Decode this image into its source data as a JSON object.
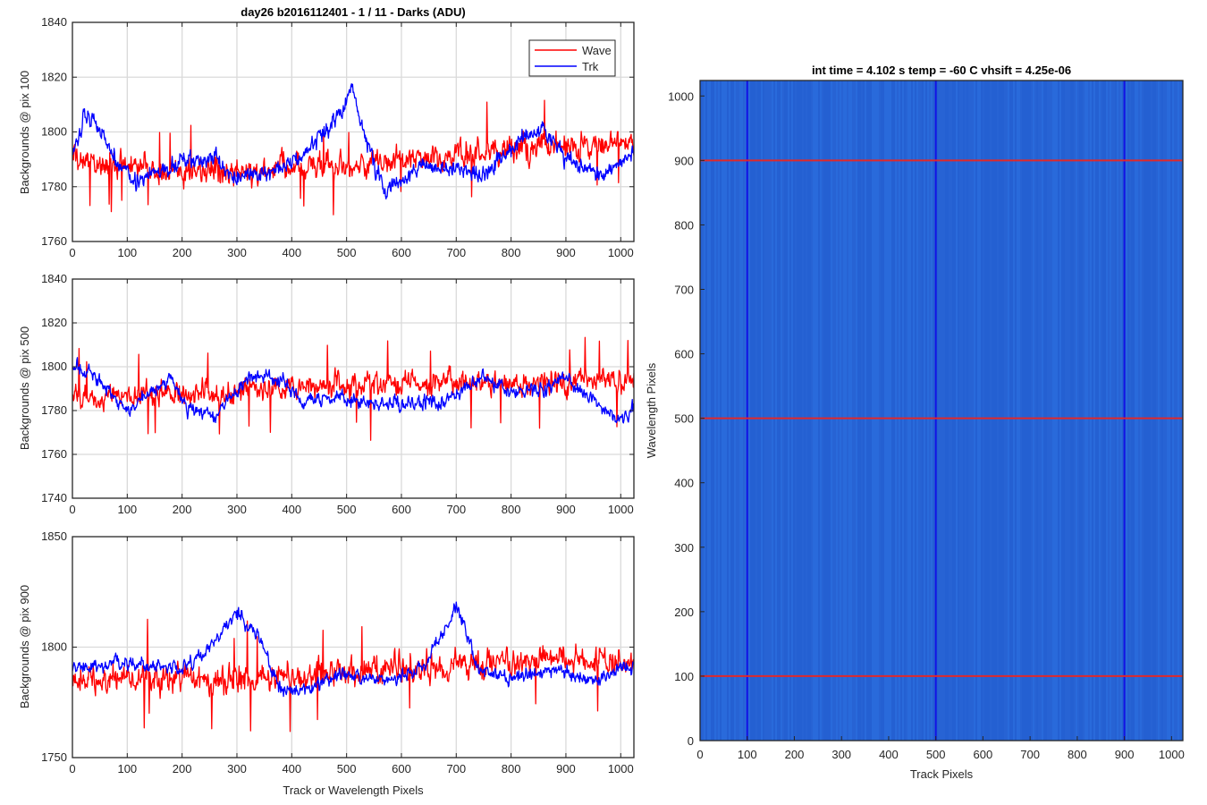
{
  "chart_data": [
    {
      "type": "line",
      "title": "day26 b2016112401 - 1 / 11 - Darks (ADU)",
      "xlabel": "",
      "ylabel": "Backgrounds @ pix 100",
      "xlim": [
        0,
        1024
      ],
      "ylim": [
        1760,
        1840
      ],
      "xticks": [
        "0",
        "100",
        "200",
        "300",
        "400",
        "500",
        "600",
        "700",
        "800",
        "900",
        "1000"
      ],
      "yticks": [
        "1760",
        "1780",
        "1800",
        "1820",
        "1840"
      ],
      "grid": true,
      "legend": {
        "placement": "top-right",
        "entries": [
          "Wave",
          "Trk"
        ]
      },
      "series": [
        {
          "name": "Wave",
          "color": "#ff0000",
          "mean": 1788,
          "noise": 6,
          "features": [
            [
              0,
              1790
            ],
            [
              100,
              1788
            ],
            [
              200,
              1786
            ],
            [
              300,
              1785
            ],
            [
              400,
              1787
            ],
            [
              500,
              1788
            ],
            [
              600,
              1790
            ],
            [
              700,
              1792
            ],
            [
              800,
              1794
            ],
            [
              900,
              1795
            ],
            [
              1024,
              1796
            ]
          ]
        },
        {
          "name": "Trk",
          "color": "#0000ff",
          "mean": 1789,
          "noise": 4,
          "features": [
            [
              0,
              1790
            ],
            [
              20,
              1806
            ],
            [
              40,
              1805
            ],
            [
              80,
              1790
            ],
            [
              120,
              1782
            ],
            [
              200,
              1789
            ],
            [
              260,
              1790
            ],
            [
              300,
              1783
            ],
            [
              360,
              1785
            ],
            [
              420,
              1792
            ],
            [
              490,
              1806
            ],
            [
              510,
              1818
            ],
            [
              530,
              1800
            ],
            [
              570,
              1778
            ],
            [
              640,
              1788
            ],
            [
              700,
              1787
            ],
            [
              760,
              1785
            ],
            [
              820,
              1798
            ],
            [
              860,
              1800
            ],
            [
              900,
              1790
            ],
            [
              960,
              1784
            ],
            [
              1024,
              1793
            ]
          ]
        }
      ]
    },
    {
      "type": "line",
      "title": "",
      "xlabel": "",
      "ylabel": "Backgrounds @ pix 500",
      "xlim": [
        0,
        1024
      ],
      "ylim": [
        1740,
        1840
      ],
      "xticks": [
        "0",
        "100",
        "200",
        "300",
        "400",
        "500",
        "600",
        "700",
        "800",
        "900",
        "1000"
      ],
      "yticks": [
        "1740",
        "1760",
        "1780",
        "1800",
        "1820",
        "1840"
      ],
      "grid": true,
      "series": [
        {
          "name": "Wave",
          "color": "#ff0000",
          "mean": 1788,
          "noise": 7,
          "features": [
            [
              0,
              1785
            ],
            [
              100,
              1787
            ],
            [
              200,
              1788
            ],
            [
              300,
              1789
            ],
            [
              400,
              1790
            ],
            [
              500,
              1792
            ],
            [
              600,
              1793
            ],
            [
              700,
              1793
            ],
            [
              800,
              1792
            ],
            [
              900,
              1793
            ],
            [
              1024,
              1794
            ]
          ]
        },
        {
          "name": "Trk",
          "color": "#0000ff",
          "mean": 1786,
          "noise": 4,
          "features": [
            [
              0,
              1800
            ],
            [
              30,
              1798
            ],
            [
              100,
              1780
            ],
            [
              180,
              1795
            ],
            [
              210,
              1780
            ],
            [
              260,
              1778
            ],
            [
              320,
              1795
            ],
            [
              380,
              1795
            ],
            [
              420,
              1784
            ],
            [
              480,
              1786
            ],
            [
              560,
              1783
            ],
            [
              600,
              1784
            ],
            [
              680,
              1784
            ],
            [
              750,
              1795
            ],
            [
              800,
              1788
            ],
            [
              860,
              1790
            ],
            [
              900,
              1795
            ],
            [
              960,
              1782
            ],
            [
              1000,
              1775
            ],
            [
              1024,
              1782
            ]
          ]
        }
      ]
    },
    {
      "type": "line",
      "title": "",
      "xlabel": "Track or Wavelength Pixels",
      "ylabel": "Backgrounds @ pix 900",
      "xlim": [
        0,
        1024
      ],
      "ylim": [
        1750,
        1850
      ],
      "xticks": [
        "0",
        "100",
        "200",
        "300",
        "400",
        "500",
        "600",
        "700",
        "800",
        "900",
        "1000"
      ],
      "yticks": [
        "1750",
        "1800",
        "1850"
      ],
      "grid": true,
      "series": [
        {
          "name": "Wave",
          "color": "#ff0000",
          "mean": 1787,
          "noise": 8,
          "features": [
            [
              0,
              1785
            ],
            [
              100,
              1786
            ],
            [
              200,
              1786
            ],
            [
              300,
              1785
            ],
            [
              400,
              1787
            ],
            [
              500,
              1789
            ],
            [
              600,
              1790
            ],
            [
              700,
              1792
            ],
            [
              800,
              1793
            ],
            [
              900,
              1795
            ],
            [
              1024,
              1792
            ]
          ]
        },
        {
          "name": "Trk",
          "color": "#0000ff",
          "mean": 1789,
          "noise": 4,
          "features": [
            [
              0,
              1790
            ],
            [
              100,
              1793
            ],
            [
              200,
              1790
            ],
            [
              250,
              1800
            ],
            [
              300,
              1815
            ],
            [
              340,
              1805
            ],
            [
              380,
              1780
            ],
            [
              440,
              1782
            ],
            [
              500,
              1788
            ],
            [
              560,
              1785
            ],
            [
              640,
              1790
            ],
            [
              700,
              1818
            ],
            [
              740,
              1790
            ],
            [
              800,
              1786
            ],
            [
              880,
              1790
            ],
            [
              940,
              1784
            ],
            [
              1000,
              1790
            ],
            [
              1024,
              1790
            ]
          ]
        }
      ]
    },
    {
      "type": "heatmap",
      "title": "int time = 4.102 s   temp = -60 C   vhsift = 4.25e-06",
      "xlabel": "Track Pixels",
      "ylabel": "Wavelength Pixels",
      "xlim": [
        0,
        1024
      ],
      "ylim": [
        0,
        1024
      ],
      "xticks": [
        "0",
        "100",
        "200",
        "300",
        "400",
        "500",
        "600",
        "700",
        "800",
        "900",
        "1000"
      ],
      "yticks": [
        "0",
        "100",
        "200",
        "300",
        "400",
        "500",
        "600",
        "700",
        "800",
        "900",
        "1000"
      ],
      "base_color": "#2566d8",
      "horizontal_markers": {
        "color": "#e0282a",
        "values": [
          100,
          500,
          900
        ]
      },
      "vertical_markers": {
        "color": "#1212e6",
        "values": [
          100,
          500,
          900
        ]
      }
    }
  ]
}
